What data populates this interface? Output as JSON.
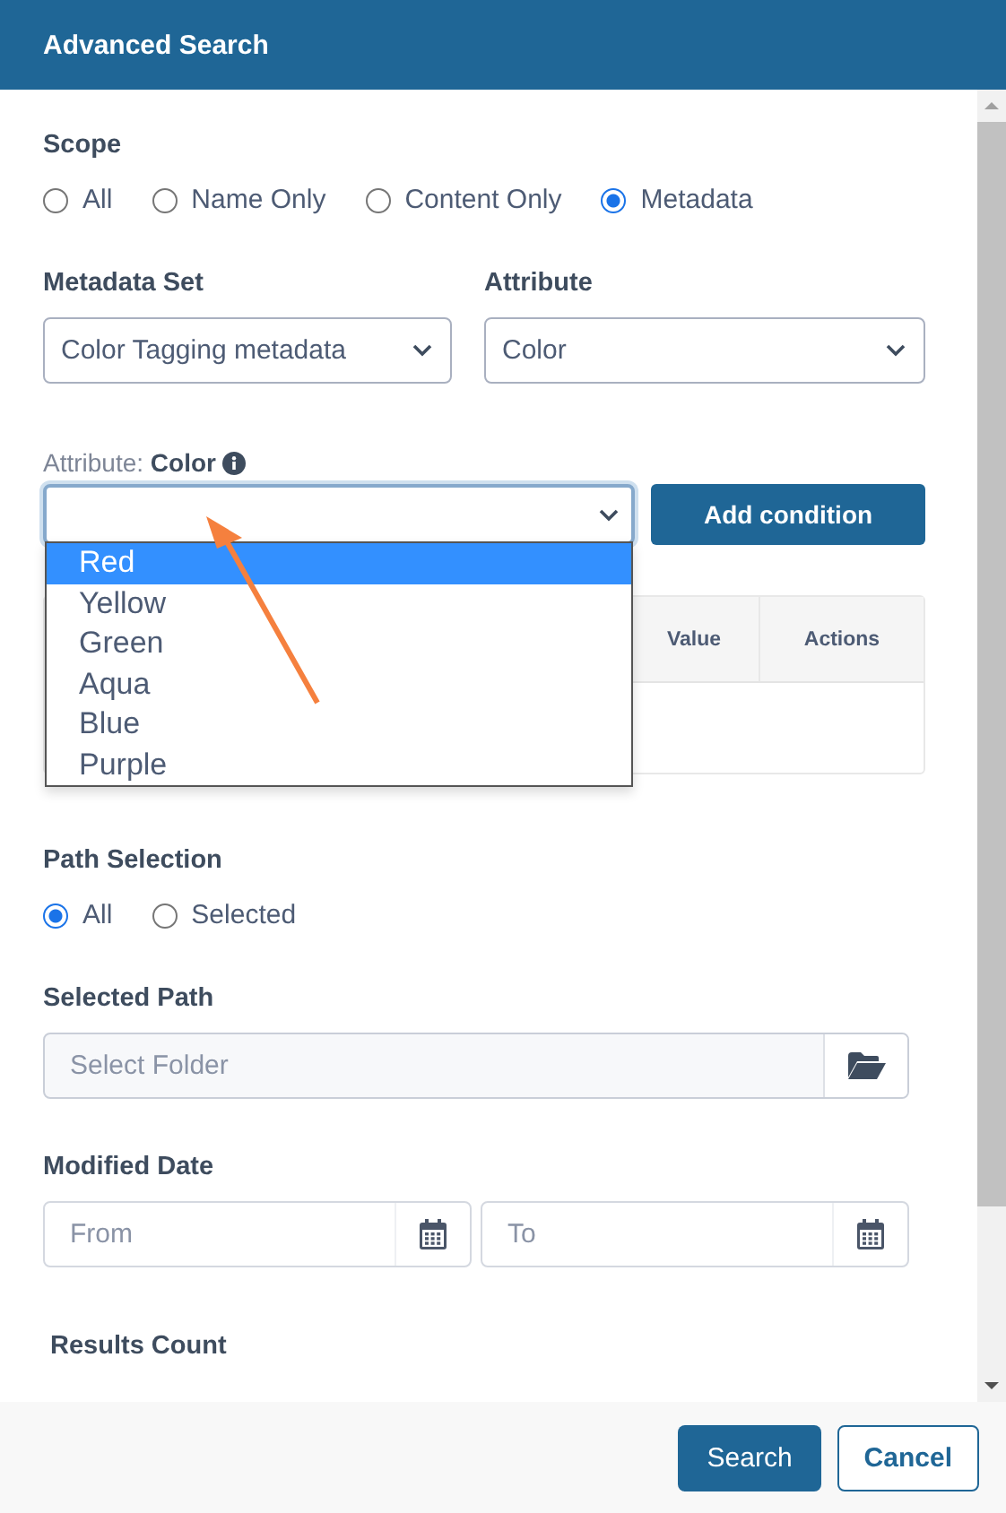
{
  "dialog": {
    "title": "Advanced Search"
  },
  "scope": {
    "label": "Scope",
    "options": [
      {
        "label": "All",
        "selected": false
      },
      {
        "label": "Name Only",
        "selected": false
      },
      {
        "label": "Content Only",
        "selected": false
      },
      {
        "label": "Metadata",
        "selected": true
      }
    ]
  },
  "metadata_set": {
    "label": "Metadata Set",
    "value": "Color Tagging metadata"
  },
  "attribute": {
    "label": "Attribute",
    "value": "Color"
  },
  "attribute_value": {
    "label_prefix": "Attribute:",
    "label_name": "Color",
    "open": true,
    "options": [
      {
        "label": "Red",
        "selected": true
      },
      {
        "label": "Yellow",
        "selected": false
      },
      {
        "label": "Green",
        "selected": false
      },
      {
        "label": "Aqua",
        "selected": false
      },
      {
        "label": "Blue",
        "selected": false
      },
      {
        "label": "Purple",
        "selected": false
      }
    ]
  },
  "add_condition_button": "Add condition",
  "conditions_table": {
    "columns": [
      "Value",
      "Actions"
    ]
  },
  "path_selection": {
    "label": "Path Selection",
    "options": [
      {
        "label": "All",
        "selected": true
      },
      {
        "label": "Selected",
        "selected": false
      }
    ]
  },
  "selected_path": {
    "label": "Selected Path",
    "placeholder": "Select Folder"
  },
  "modified_date": {
    "label": "Modified Date",
    "from": {
      "placeholder": "From"
    },
    "to": {
      "placeholder": "To"
    }
  },
  "results_count": {
    "label": "Results Count"
  },
  "buttons": [
    {
      "label": "Search",
      "kind": "primary"
    },
    {
      "label": "Cancel",
      "kind": "secondary"
    }
  ]
}
